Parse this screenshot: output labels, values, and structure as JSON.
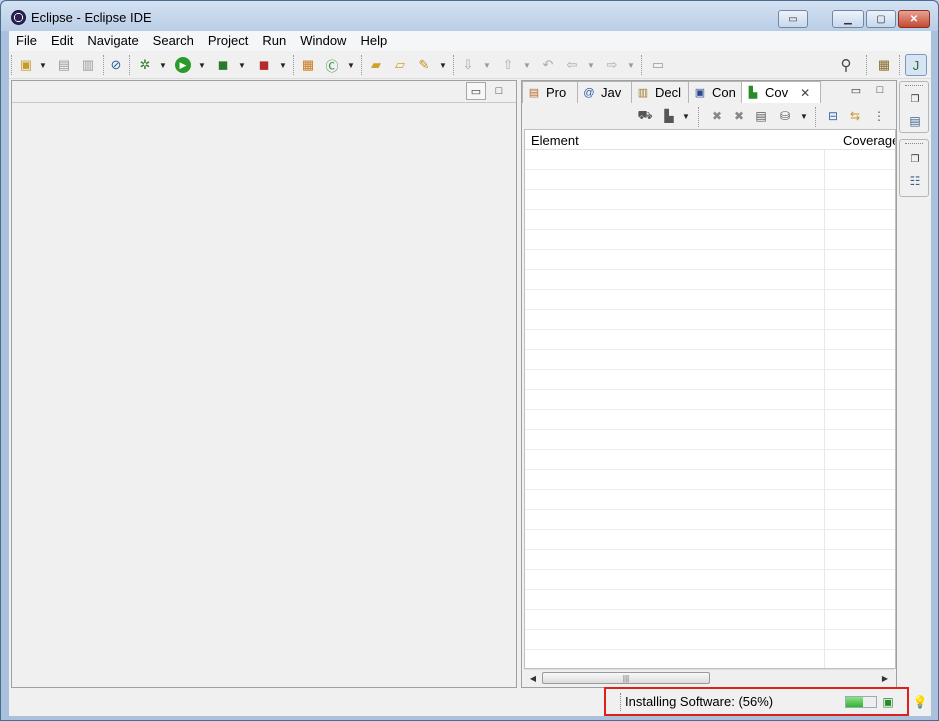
{
  "window": {
    "title": "Eclipse - Eclipse IDE",
    "titlebar_buttons": [
      "restore-layout",
      "minimize",
      "maximize",
      "close"
    ]
  },
  "menu": [
    "File",
    "Edit",
    "Navigate",
    "Search",
    "Project",
    "Run",
    "Window",
    "Help"
  ],
  "toolbar": {
    "icons": [
      "new-icon",
      "save-icon",
      "save-all-icon",
      "skip-breakpoints-icon",
      "debug-icon",
      "run-icon",
      "coverage-icon",
      "external-tools-icon",
      "new-java-package-icon",
      "new-java-class-icon",
      "open-type-icon",
      "open-task-icon",
      "search-references-icon",
      "next-annotation-icon",
      "previous-annotation-icon",
      "last-edit-location-icon",
      "back-icon",
      "forward-icon",
      "pin-editor-icon",
      "search-icon",
      "open-perspective-icon",
      "java-perspective-icon"
    ]
  },
  "view": {
    "tabs": [
      {
        "label": "Pro",
        "icon": "project-explorer-icon"
      },
      {
        "label": "Jav",
        "icon": "javadoc-icon"
      },
      {
        "label": "Decl",
        "icon": "declaration-icon"
      },
      {
        "label": "Con",
        "icon": "console-icon"
      },
      {
        "label": "Cov",
        "icon": "coverage-view-icon",
        "active": true
      }
    ],
    "toolbar_icons": [
      "relaunch-icon",
      "merge-sessions-icon",
      "remove-session-icon",
      "remove-all-sessions-icon",
      "select-session-icon",
      "dump-execution-data-icon",
      "collapse-all-icon",
      "link-with-selection-icon",
      "view-menu-icon"
    ],
    "columns": [
      "Element",
      "Coverage"
    ]
  },
  "status": {
    "text": "Installing Software: (56%)",
    "progress": 0.56
  },
  "colors": {
    "highlight_border": "#e0201c",
    "progress_fill": "#2fb52c",
    "window_frame": "#a9c1dc"
  }
}
